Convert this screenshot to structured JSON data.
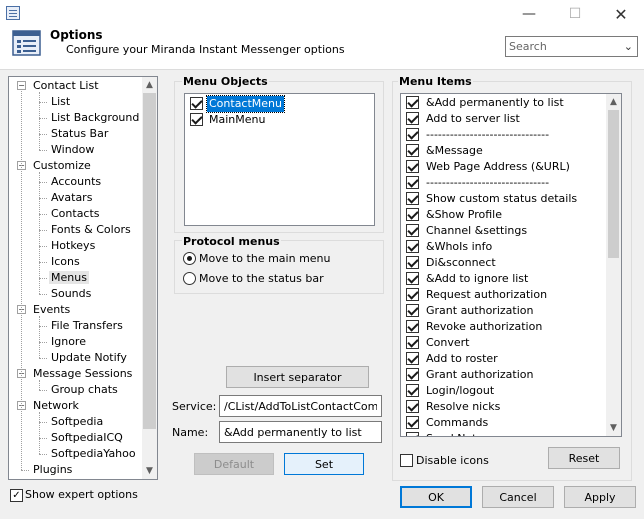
{
  "window": {
    "title": "",
    "minimize_glyph": "—",
    "maximize_glyph": "☐",
    "close_glyph": "✕"
  },
  "header": {
    "title": "Options",
    "subtitle": "Configure your Miranda Instant Messenger options",
    "search_value": "Search",
    "dropdown_icon": "chevron-down-icon"
  },
  "tree": {
    "items": [
      {
        "label": "Contact List",
        "level": 0,
        "expanded": true
      },
      {
        "label": "List",
        "level": 1
      },
      {
        "label": "List Background",
        "level": 1
      },
      {
        "label": "Status Bar",
        "level": 1
      },
      {
        "label": "Window",
        "level": 1
      },
      {
        "label": "Customize",
        "level": 0,
        "expanded": true
      },
      {
        "label": "Accounts",
        "level": 1
      },
      {
        "label": "Avatars",
        "level": 1
      },
      {
        "label": "Contacts",
        "level": 1
      },
      {
        "label": "Fonts & Colors",
        "level": 1
      },
      {
        "label": "Hotkeys",
        "level": 1
      },
      {
        "label": "Icons",
        "level": 1
      },
      {
        "label": "Menus",
        "level": 1,
        "selected": true
      },
      {
        "label": "Sounds",
        "level": 1
      },
      {
        "label": "Events",
        "level": 0,
        "expanded": true
      },
      {
        "label": "File Transfers",
        "level": 1
      },
      {
        "label": "Ignore",
        "level": 1
      },
      {
        "label": "Update Notify",
        "level": 1
      },
      {
        "label": "Message Sessions",
        "level": 0,
        "expanded": true
      },
      {
        "label": "Group chats",
        "level": 1
      },
      {
        "label": "Network",
        "level": 0,
        "expanded": true
      },
      {
        "label": "Softpedia",
        "level": 1
      },
      {
        "label": "SoftpediaICQ",
        "level": 1
      },
      {
        "label": "SoftpediaYahoo",
        "level": 1
      },
      {
        "label": "Plugins",
        "level": 0
      }
    ]
  },
  "show_expert": {
    "label": "Show expert options",
    "checked": true
  },
  "menu_objects": {
    "title": "Menu Objects",
    "items": [
      {
        "label": "ContactMenu",
        "checked": true,
        "selected": true
      },
      {
        "label": "MainMenu",
        "checked": true
      }
    ]
  },
  "protocol_menus": {
    "title": "Protocol menus",
    "options": [
      {
        "label": "Move to the main menu",
        "selected": true
      },
      {
        "label": "Move to the status bar",
        "selected": false
      }
    ]
  },
  "insert_separator_label": "Insert separator",
  "service": {
    "label": "Service:",
    "value": "/CList/AddToListContactCommand"
  },
  "name": {
    "label": "Name:",
    "value": "&Add permanently to list"
  },
  "default_label": "Default",
  "set_label": "Set",
  "menu_items": {
    "title": "Menu Items",
    "items": [
      "&Add permanently to list",
      "Add to server list",
      "-------------------------------",
      "&Message",
      "Web Page Address (&URL)",
      "-------------------------------",
      "Show custom status details",
      "&Show Profile",
      "Channel &settings",
      "&WhoIs info",
      "Di&sconnect",
      "&Add to ignore list",
      "Request authorization",
      "Grant authorization",
      "Revoke authorization",
      "Convert",
      "Add to roster",
      "Grant authorization",
      "Login/logout",
      "Resolve nicks",
      "Commands",
      "Send Note"
    ]
  },
  "disable_icons_label": "Disable icons",
  "reset_label": "Reset",
  "ok_label": "OK",
  "cancel_label": "Cancel",
  "apply_label": "Apply",
  "colors": {
    "accent": "#0078d7",
    "selection_bg": "#0078d7"
  }
}
